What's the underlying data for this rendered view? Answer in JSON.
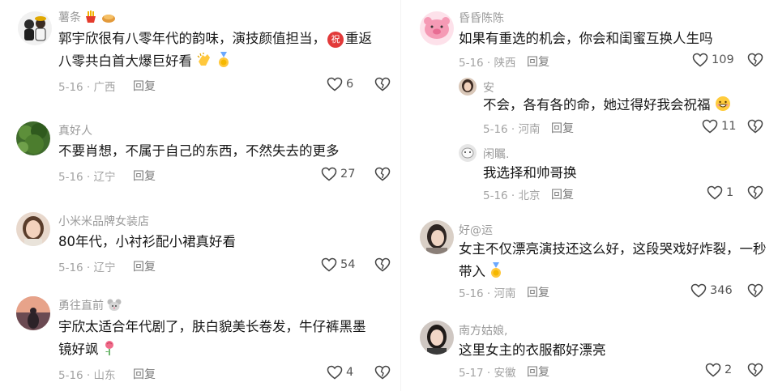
{
  "left_column": [
    {
      "username": "薯条",
      "text_line1": "郭宇欣很有八零年代的韵味，演技颜值担当，",
      "badge": "祝",
      "text_line1_after": "重返",
      "text_line2": "八零共白首大爆巨好看",
      "date_location": "5-16 · 广西",
      "reply": "回复",
      "likes": "6"
    },
    {
      "username": "真好人",
      "text_line1": "不要肖想，不属于自己的东西，不然失去的更多",
      "date_location": "5-16 · 辽宁",
      "reply": "回复",
      "likes": "27"
    },
    {
      "username": "小米米品牌女装店",
      "text_line1": "80年代，小衬衫配小裙真好看",
      "date_location": "5-16 · 辽宁",
      "reply": "回复",
      "likes": "54"
    },
    {
      "username": "勇往直前",
      "text_line1": "宇欣太适合年代剧了，肤白貌美长卷发，牛仔裤黑墨",
      "text_line2": "镜好飒",
      "date_location": "5-16 · 山东",
      "reply": "回复",
      "likes": "4"
    }
  ],
  "right_column": [
    {
      "username": "昏昏陈陈",
      "text_line1": "如果有重选的机会，你会和闺蜜互换人生吗",
      "date_location": "5-16 · 陕西",
      "reply": "回复",
      "likes": "109"
    },
    {
      "username": "安",
      "text_line1": "不会，各有各的命，她过得好我会祝福",
      "date_location": "5-16 · 河南",
      "reply": "回复",
      "likes": "11"
    },
    {
      "username": "闲瞩.",
      "text_line1": "我选择和帅哥换",
      "date_location": "5-16 · 北京",
      "reply": "回复",
      "likes": "1"
    },
    {
      "username": "好@运",
      "text_line1": "女主不仅漂亮演技还这么好，这段哭戏好炸裂，一秒",
      "text_line2": "带入",
      "date_location": "5-16 · 河南",
      "reply": "回复",
      "likes": "346"
    },
    {
      "username": "南方姑娘,",
      "text_line1": "这里女主的衣服都好漂亮",
      "date_location": "5-17 · 安徽",
      "reply": "回复",
      "likes": "2"
    }
  ]
}
